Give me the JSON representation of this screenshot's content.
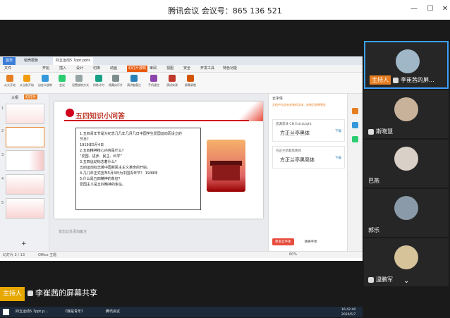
{
  "meeting": {
    "title": "腾讯会议 会议号：865 136 521",
    "shared_label": "李崔茜的屏幕共享",
    "host_tag": "主持人"
  },
  "wps": {
    "tabs": [
      "首页",
      "稻壳模板",
      "四五运动5.7ppt.pptx"
    ],
    "menu": [
      "文件",
      "开始",
      "插入",
      "设计",
      "切换",
      "动画",
      "幻灯片放映",
      "审阅",
      "视图",
      "安全",
      "开发工具",
      "特色功能"
    ],
    "ribbon": [
      "从头开始",
      "从当前开始",
      "自定义放映",
      "会议",
      "设置放映方式",
      "排练计时",
      "隐藏幻灯片",
      "演讲者备注",
      "手机遥控",
      "演讲实录",
      "屏幕录制"
    ],
    "thumb_tabs": [
      "大纲",
      "幻灯片"
    ],
    "slide_numbers": [
      "1",
      "2",
      "3",
      "4",
      "5"
    ],
    "status_left": "幻灯片 2 / 13",
    "status_theme": "Office 主题",
    "zoom": "60%",
    "notes_placeholder": "单击此处添加备注",
    "slide": {
      "title": "五四知识小问答",
      "lines": [
        "1.五四青年节是为纪念几几年几月几日中国学生爱国运动而设立的",
        "节日？",
        "1919年5月4日",
        "2.五四精神核心内容是什么？",
        "“爱国、进步、民主、科学”",
        "3.五四运动标志着什么？",
        "五四运动标志着中国新民主主义革命的开始。",
        "4.几几年正式宣布5月4日为中国青年节？  1949年",
        "5.什么是五四精神的象征？",
        "爱国主义是五四精神的象征。"
      ]
    },
    "right_pane": {
      "header": "云字体",
      "tip": "文档中包含未安装的字体，安装后效果更佳",
      "fonts": [
        {
          "name": "思源黑体 CN ExtraLight",
          "preview": "方正兰亭黑体",
          "action": "下载"
        },
        {
          "name": "方正兰亭超黑简体",
          "preview": "方正兰亭黑简体",
          "action": "下载"
        }
      ],
      "btn_primary": "更多云字体",
      "btn_secondary": "替换字体"
    }
  },
  "taskbar": {
    "items": [
      "四五运动5.7ppt.p...",
      "《我是青年》",
      "腾讯会议"
    ],
    "time": "16:42:40",
    "date": "2020/5/7"
  },
  "participants": [
    {
      "name": "李崔茜的屏...",
      "host": true,
      "active": true,
      "avatar_color": "#9fb7c7"
    },
    {
      "name": "斯晓慧",
      "host": false,
      "active": false,
      "avatar_color": "#c8b39a"
    },
    {
      "name": "巴燕",
      "host": false,
      "active": false,
      "avatar_color": "#d9d0c8"
    },
    {
      "name": "郭乐",
      "host": false,
      "active": false,
      "avatar_color": "#8a9aa8"
    },
    {
      "name": "逯鹏军",
      "host": false,
      "active": false,
      "avatar_color": "#d6c39a"
    }
  ],
  "colors": {
    "accent_red": "#d0021b",
    "host_orange": "#e67e22",
    "active_blue": "#3ea0ff"
  }
}
